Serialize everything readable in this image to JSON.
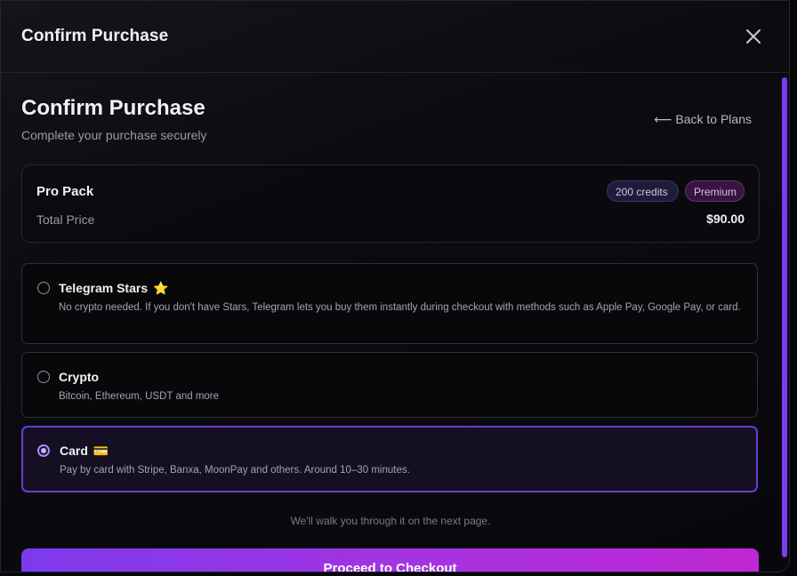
{
  "header": {
    "title": "Confirm Purchase",
    "close_icon": "close-icon"
  },
  "page": {
    "title": "Confirm Purchase",
    "subtitle": "Complete your purchase securely",
    "back_arrow": "⟵",
    "back_label": "Back to Plans"
  },
  "summary": {
    "pack_name": "Pro Pack",
    "credits_badge": "200 credits",
    "tier_badge": "Premium",
    "total_label": "Total Price",
    "price": "$90.00"
  },
  "payment_options": [
    {
      "title": "Telegram Stars",
      "emoji": "⭐",
      "description": "No crypto needed. If you don't have Stars, Telegram lets you buy them instantly during checkout with methods such as Apple Pay, Google Pay, or card.",
      "selected": false
    },
    {
      "title": "Crypto",
      "emoji": "",
      "description": "Bitcoin, Ethereum, USDT and more",
      "selected": false
    },
    {
      "title": "Card",
      "emoji": "💳",
      "description": "Pay by card with Stripe, Banxa, MoonPay and others. Around 10–30 minutes.",
      "selected": true
    }
  ],
  "footer": {
    "note": "We'll walk you through it on the next page.",
    "cta_label": "Proceed to Checkout"
  },
  "colors": {
    "accent": "#7c3aed",
    "accent_end": "#c026d3",
    "selected_border": "#6a3bd6",
    "scrollbar": "#7b3cf0"
  }
}
